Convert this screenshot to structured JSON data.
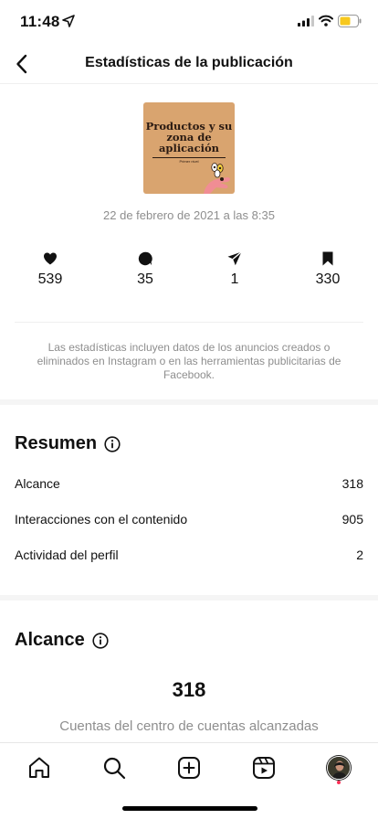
{
  "status_bar": {
    "time": "11:48"
  },
  "header": {
    "title": "Estadísticas de la publicación"
  },
  "post": {
    "thumbnail_title": "Productos y su zona de aplicación",
    "thumbnail_subtitle": "Primer nivel",
    "date": "22 de febrero de 2021 a las 8:35"
  },
  "metrics": [
    {
      "icon": "heart-icon",
      "value": "539"
    },
    {
      "icon": "comment-icon",
      "value": "35"
    },
    {
      "icon": "share-icon",
      "value": "1"
    },
    {
      "icon": "bookmark-icon",
      "value": "330"
    }
  ],
  "disclaimer": "Las estadísticas incluyen datos de los anuncios creados o eliminados en Instagram o en las herramientas publicitarias de Facebook.",
  "summary": {
    "title": "Resumen",
    "rows": [
      {
        "label": "Alcance",
        "value": "318"
      },
      {
        "label": "Interacciones con el contenido",
        "value": "905"
      },
      {
        "label": "Actividad del perfil",
        "value": "2"
      }
    ]
  },
  "reach": {
    "title": "Alcance",
    "value": "318",
    "caption": "Cuentas del centro de cuentas alcanzadas"
  },
  "tab_bar": {
    "tabs": [
      "home-icon",
      "search-icon",
      "add-post-icon",
      "reels-icon",
      "profile-avatar"
    ],
    "notification_color": "#ff2f56"
  }
}
